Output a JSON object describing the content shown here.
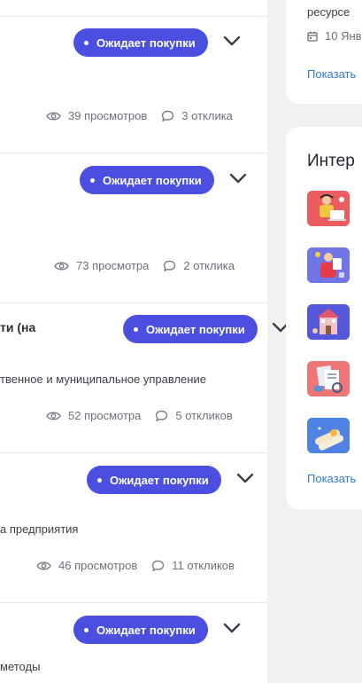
{
  "cards": [
    {
      "status": "Ожидает покупки",
      "title_fragment": "",
      "subject": "",
      "views": "39 просмотров",
      "responses": "3 отклика"
    },
    {
      "status": "Ожидает покупки",
      "title_fragment": "",
      "subject": "",
      "views": "73 просмотра",
      "responses": "2 отклика"
    },
    {
      "status": "Ожидает покупки",
      "title_fragment": "ти (на",
      "subject": "твенное и муниципальное управление",
      "views": "52 просмотра",
      "responses": "5 откликов"
    },
    {
      "status": "Ожидает покупки",
      "title_fragment": "",
      "subject": "а предприятия",
      "views": "46 просмотров",
      "responses": "11 откликов"
    },
    {
      "status": "Ожидает покупки",
      "title_fragment": "",
      "subject": " методы",
      "views": "",
      "responses": ""
    }
  ],
  "right_top": {
    "text": "ресурсе",
    "date": "10 Янв",
    "link": "Показать"
  },
  "right_bottom": {
    "heading": "Интер",
    "link": "Показать",
    "thumbnails": [
      "person-with-laptop-thumb",
      "person-with-tablet-thumb",
      "house-illustration-thumb",
      "documents-thumb",
      "scrolls-thumb"
    ]
  },
  "colors": {
    "accent": "#4a4fe0",
    "link": "#2f7dd1",
    "background": "#f1f1f4"
  }
}
